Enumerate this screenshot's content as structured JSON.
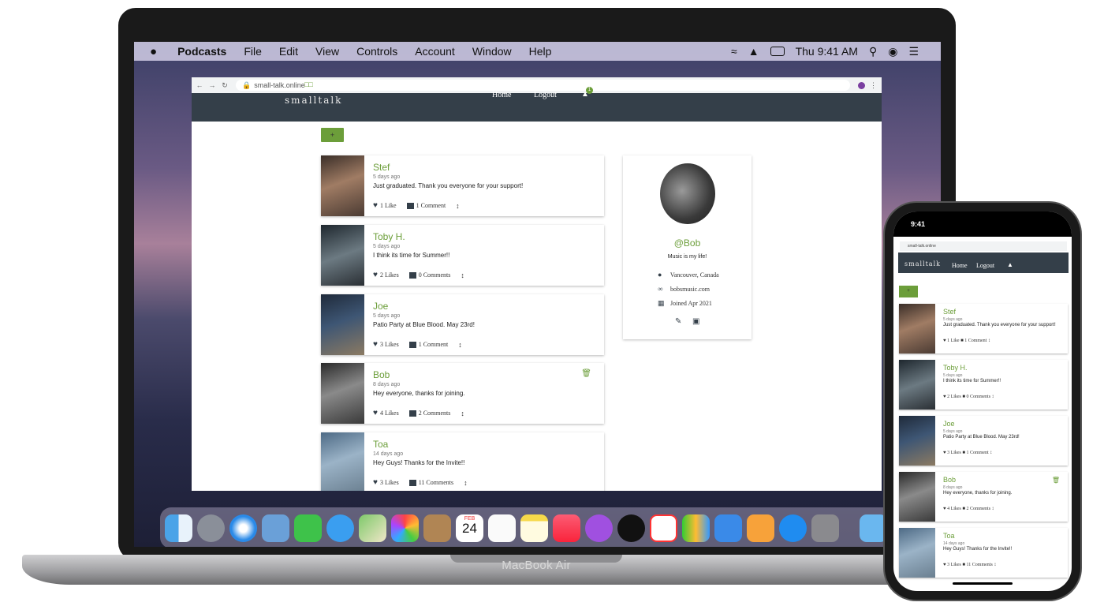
{
  "menubar": {
    "apple_icon": "apple-logo-icon",
    "app_name": "Podcasts",
    "menus": [
      "File",
      "Edit",
      "View",
      "Controls",
      "Account",
      "Window",
      "Help"
    ],
    "clock": "Thu 9:41 AM"
  },
  "browser": {
    "url": "small-talk.online"
  },
  "site": {
    "logo_text": "smalltalk",
    "nav_home": "Home",
    "nav_logout": "Logout",
    "notification_count": "1",
    "add_button_label": "+"
  },
  "posts": [
    {
      "name": "Stef",
      "time": "5 days ago",
      "text": "Just graduated. Thank you everyone for your support!",
      "likes": "1 Like",
      "comments": "1 Comment",
      "photo_color": "#6b5a4d"
    },
    {
      "name": "Toby H.",
      "time": "5 days ago",
      "text": "I think its time for Summer!!",
      "likes": "2 Likes",
      "comments": "0 Comments",
      "photo_color": "#3a4650"
    },
    {
      "name": "Joe",
      "time": "5 days ago",
      "text": "Patio Party at Blue Blood. May 23rd!",
      "likes": "3 Likes",
      "comments": "1 Comment",
      "photo_color": "#4a5a70"
    },
    {
      "name": "Bob",
      "time": "8 days ago",
      "text": "Hey everyone, thanks for joining.",
      "likes": "4 Likes",
      "comments": "2 Comments",
      "photo_color": "#5a5a5a"
    },
    {
      "name": "Toa",
      "time": "14 days ago",
      "text": "Hey Guys! Thanks for the Invite!!",
      "likes": "3 Likes",
      "comments": "11 Comments",
      "photo_color": "#5f7d96"
    }
  ],
  "profile": {
    "handle": "@Bob",
    "bio": "Music is my life!",
    "location": "Vancouver, Canada",
    "website": "bobsmusic.com",
    "joined": "Joined Apr 2021"
  },
  "laptop_brand": "MacBook Air",
  "phone": {
    "status_time": "9:41",
    "url": "small-talk.online"
  },
  "dock": {
    "calendar_month": "FEB",
    "calendar_day": "24",
    "apps": [
      "finder",
      "launchpad",
      "safari",
      "mail",
      "facetime",
      "messages",
      "maps",
      "photos",
      "contacts",
      "calendar",
      "reminders",
      "notes",
      "music",
      "podcasts",
      "tv",
      "news",
      "numbers",
      "keynote",
      "pages",
      "app-store",
      "system-preferences",
      "downloads"
    ]
  },
  "colors": {
    "accent": "#6c9e3a",
    "navbar": "#343f49"
  }
}
